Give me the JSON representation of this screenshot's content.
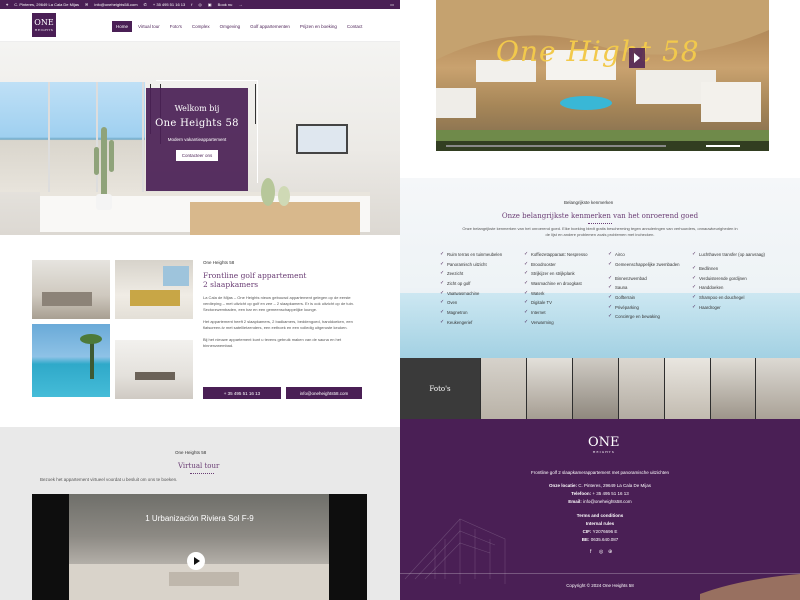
{
  "topbar": {
    "address": "C. Pinteres, 29649 La Cala De Mijas",
    "email": "info@oneheights58.com",
    "phone": "+ 35 495 51 16 13",
    "book": "Book nu"
  },
  "nav": {
    "logo": "ONE",
    "logo_sub": "HEIGHTS",
    "items": [
      "Home",
      "Virtual tour",
      "Foto's",
      "Complex",
      "Omgeving",
      "Golf appartementen",
      "Prijzen en boeking",
      "Contact"
    ]
  },
  "hero": {
    "welcome": "Welkom bij",
    "title": "One Heights 58",
    "subtitle": "Modern vakantieappartement",
    "button": "Contacteer ons"
  },
  "intro": {
    "kicker": "One Heights 58",
    "heading_line1": "Frontline golf appartement",
    "heading_line2": "2 slaapkamers",
    "para1": "La Cala de Mijas – One Heights nieuw gebouwd appartement gelegen op de eerste verdieping – met uitzicht op golf en zee – 2 slaapkamers. Er is ook uitzicht op de tuin. Sectorzwembaden, een bar en een gemeenschappelijke lounge.",
    "para2": "Het appartement heeft 2 slaapkamers, 2 badkamers, beddengoed, handdoeken, een flatscreen-tv met satellietzenders, een eethoek en een volledig uitgeruste keuken.",
    "para3": "Bij het nieuwe appartement kunt u tevens gebruik maken van de sauna en het binnenzwembad.",
    "phone_button": "+ 35 495 51 16 13",
    "email_button": "info@oneheights58.com"
  },
  "virtual_tour": {
    "kicker": "One Heights 58",
    "heading": "Virtual tour",
    "desc": "Bezoek het appartement virtueel voordat u besluit om ons te boeken.",
    "video_title": "1 Urbanización Riviera Sol F-9"
  },
  "promo_video": {
    "script_title": "One Hight 58"
  },
  "features": {
    "kicker": "Belangrijkste kenmerken",
    "heading": "Onze belangrijkste kenmerken van het onroerend goed",
    "intro": "Onze belangrijkste kenmerken van het onroerend goed. Elke boeking biedt gratis bescherming tegen annuleringen van verhuurders, onnauwkeurigheden in de lijst en andere problemen zoals problemen met inchecken.",
    "col1": [
      "Ruim terras en tuinmeubelen",
      "Panoramisch uitzicht",
      "Zeezicht",
      "Zicht op golf",
      "Vaatwasmachine",
      "Oven",
      "Magnetron",
      "Keukengerief"
    ],
    "col2": [
      "Koffiezetapparaat: Nespresso",
      "Broodrooster",
      "Strijkijzer en strijkplank",
      "Wasmachine en droogkast",
      "Waterk",
      "Digitale TV",
      "Internet",
      "Verwarming"
    ],
    "col3": [
      "Airco",
      "Gemeenschappelijke zwembaden",
      "Binnenzwembad",
      "Sauna",
      "Golfterrain",
      "Privéparking",
      "Conciërge en bewaking"
    ],
    "col4": [
      "Luchthaven transfer (op aanvraag)",
      "Bedlinnen",
      "Verduisterende gordijnen",
      "Handdoeken",
      "Shampoo en douchegel",
      "Haardroger"
    ]
  },
  "photos": {
    "label": "Foto's"
  },
  "footer": {
    "logo": "ONE",
    "logo_sub": "HEIGHTS",
    "tagline": "Frontline golf 2 slaapkamerappartement met panoramische uitzichten",
    "location_label": "Onze locatie:",
    "location": "C. Pinteres, 29649 La Cala De Mijas",
    "phone_label": "Telefoon:",
    "phone": "+ 35 495 51 16 13",
    "email_label": "Email:",
    "email": "info@oneheights58.com",
    "terms": "Terms and conditions",
    "rules": "Internal rules",
    "cif_label": "CIF:",
    "cif": "Y2076696 E",
    "be_label": "BE:",
    "be": "0635.640.087",
    "copyright": "Copyright © 2024 One Heights 58"
  }
}
